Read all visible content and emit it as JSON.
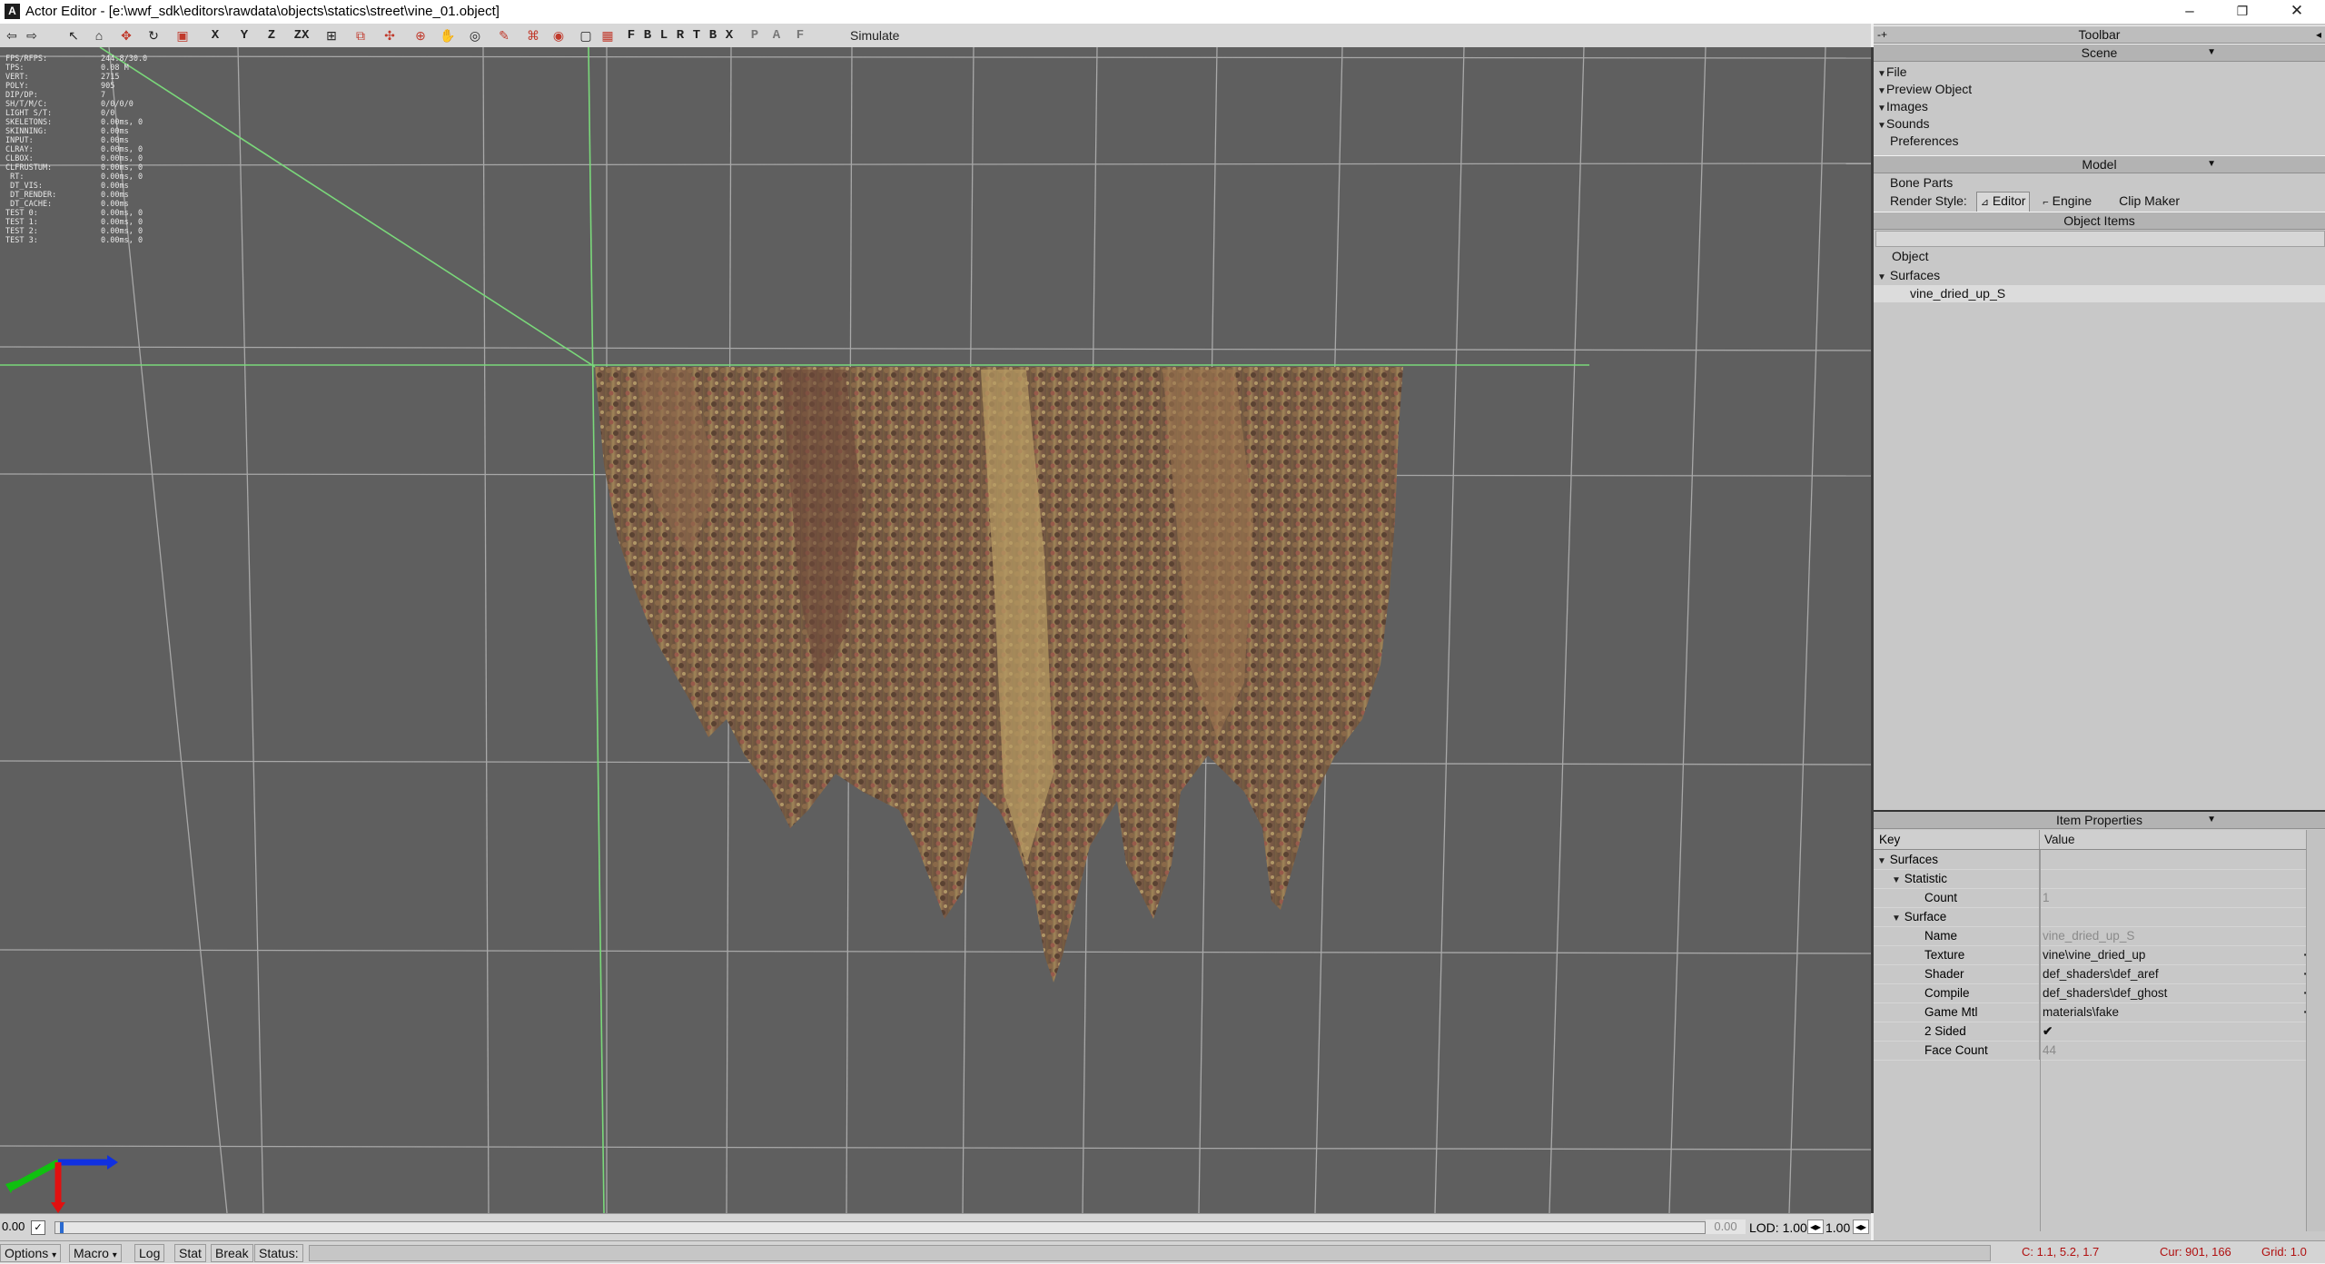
{
  "window": {
    "title": "Actor Editor - [e:\\wwf_sdk\\editors\\rawdata\\objects\\statics\\street\\vine_01.object]",
    "app_icon": "A",
    "minimize": "–",
    "restore": "❐",
    "close": "✕"
  },
  "toolbar": {
    "axis_labels": [
      "X",
      "Y",
      "Z",
      "ZX"
    ],
    "view_letters": [
      "F",
      "B",
      "L",
      "R",
      "T",
      "B",
      "X"
    ],
    "pa_letters": [
      "P",
      "A",
      "F"
    ],
    "simulate": "Simulate"
  },
  "stats": [
    {
      "k": "FPS/RFPS:",
      "v": "244.8/30.0"
    },
    {
      "k": "TPS:",
      "v": "0.08 M"
    },
    {
      "k": "VERT:",
      "v": "2715"
    },
    {
      "k": "POLY:",
      "v": "905"
    },
    {
      "k": "DIP/DP:",
      "v": "7"
    },
    {
      "k": "SH/T/M/C:",
      "v": "0/0/0/0"
    },
    {
      "k": "LIGHT S/T:",
      "v": "0/0"
    },
    {
      "k": "SKELETONS:",
      "v": "0.00ms, 0"
    },
    {
      "k": "SKINNING:",
      "v": "0.00ms"
    },
    {
      "k": "",
      "v": ""
    },
    {
      "k": "INPUT:",
      "v": "0.00ms"
    },
    {
      "k": "CLRAY:",
      "v": "0.00ms, 0"
    },
    {
      "k": "CLBOX:",
      "v": "0.00ms, 0"
    },
    {
      "k": "CLFRUSTUM:",
      "v": "0.00ms, 0"
    },
    {
      "k": "",
      "v": ""
    },
    {
      "k": " RT:",
      "v": "0.00ms, 0"
    },
    {
      "k": " DT_VIS:",
      "v": "0.00ms"
    },
    {
      "k": " DT_RENDER:",
      "v": "0.00ms"
    },
    {
      "k": " DT_CACHE:",
      "v": "0.00ms"
    },
    {
      "k": "",
      "v": ""
    },
    {
      "k": "TEST 0:",
      "v": "0.00ms, 0"
    },
    {
      "k": "TEST 1:",
      "v": "0.00ms, 0"
    },
    {
      "k": "TEST 2:",
      "v": "0.00ms, 0"
    },
    {
      "k": "TEST 3:",
      "v": "0.00ms, 0"
    }
  ],
  "timeline": {
    "left_value": "0.00",
    "right_value": "0.00",
    "lod_label": "LOD: 1.00",
    "lod_value": "1.00"
  },
  "statusbar": {
    "options": "Options",
    "macro": "Macro",
    "log": "Log",
    "stat": "Stat",
    "break": "Break",
    "status": "Status:",
    "camera": "C: 1.1, 5.2, 1.7",
    "cursor": "Cur: 901, 166",
    "grid": "Grid: 1.0"
  },
  "panel": {
    "toolbar_header": "Toolbar",
    "scene_header": "Scene",
    "scene_items": [
      "File",
      "Preview Object",
      "Images",
      "Sounds",
      "Preferences"
    ],
    "model_header": "Model",
    "bone_parts": "Bone Parts",
    "render_style_label": "Render Style:",
    "render_editor": "Editor",
    "render_engine": "Engine",
    "clip_maker": "Clip Maker",
    "object_items_header": "Object Items",
    "tree": {
      "object": "Object",
      "surfaces": "Surfaces",
      "surface_item": "vine_dried_up_S"
    },
    "item_properties_header": "Item Properties",
    "props": {
      "key_header": "Key",
      "value_header": "Value",
      "surfaces": "Surfaces",
      "statistic": "Statistic",
      "count_label": "Count",
      "count_value": "1",
      "surface": "Surface",
      "name_label": "Name",
      "name_value": "vine_dried_up_S",
      "texture_label": "Texture",
      "texture_value": "vine\\vine_dried_up",
      "shader_label": "Shader",
      "shader_value": "def_shaders\\def_aref",
      "compile_label": "Compile",
      "compile_value": "def_shaders\\def_ghost",
      "gamemtl_label": "Game Mtl",
      "gamemtl_value": "materials\\fake",
      "twosided_label": "2 Sided",
      "twosided_value": "✔",
      "facecount_label": "Face Count",
      "facecount_value": "44"
    }
  }
}
